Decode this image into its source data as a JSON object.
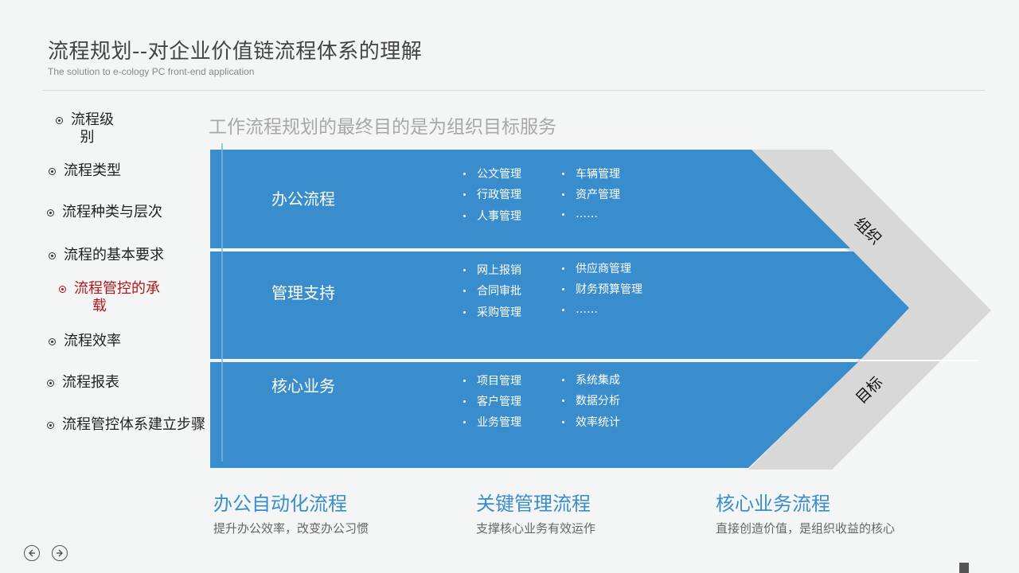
{
  "header": {
    "title": "流程规划--对企业价值链流程体系的理解",
    "subtitle": "The solution to e-cology PC front-end application"
  },
  "sidebar": {
    "items": [
      {
        "label": "流程级\n  别",
        "active": false
      },
      {
        "label": "流程类型",
        "active": false
      },
      {
        "label": "流程种类与层次",
        "active": false
      },
      {
        "label": "流程的基本要求",
        "active": false
      },
      {
        "label": "流程管控的承\n    载",
        "active": true
      },
      {
        "label": "流程效率",
        "active": false
      },
      {
        "label": "流程报表",
        "active": false
      },
      {
        "label": "流程管控体系建立步骤",
        "active": false
      }
    ]
  },
  "main": {
    "headline": "工作流程规划的最终目的是为组织目标服务",
    "bands": [
      {
        "title": "办公流程",
        "col1": [
          "公文管理",
          "行政管理",
          "人事管理"
        ],
        "col2": [
          "车辆管理",
          "资产管理",
          "……"
        ]
      },
      {
        "title": "管理支持",
        "col1": [
          "网上报销",
          "合同审批",
          "采购管理"
        ],
        "col2": [
          "供应商管理",
          "财务预算管理",
          "……"
        ]
      },
      {
        "title": "核心业务",
        "col1": [
          "项目管理",
          "客户管理",
          "业务管理"
        ],
        "col2": [
          "系统集成",
          "数据分析",
          "效率统计"
        ]
      }
    ],
    "arrow_labels": {
      "top": "组织",
      "bottom": "目标"
    },
    "summary": [
      {
        "heading": "办公自动化流程",
        "desc": "提升办公效率，改变办公习惯"
      },
      {
        "heading": "关键管理流程",
        "desc": "支撑核心业务有效运作"
      },
      {
        "heading": "核心业务流程",
        "desc": "直接创造价值，是组织收益的核心"
      }
    ]
  },
  "footer": {
    "prev_icon": "arrow-left-circle-icon",
    "next_icon": "arrow-right-circle-icon"
  },
  "colors": {
    "band_blue": "#3a8dcc",
    "chevron_gray": "#d8d8d8",
    "active_red": "#b0171c",
    "heading_blue": "#3a8dcc"
  }
}
